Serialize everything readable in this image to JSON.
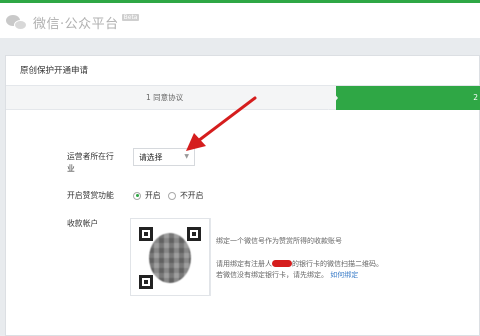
{
  "header": {
    "title": "微信·公众平台",
    "badge": "Beta"
  },
  "card": {
    "title": "原创保护开通申请"
  },
  "steps": {
    "current_label": "1 同意协议",
    "next_number": "2"
  },
  "form": {
    "industry_label_line1": "运营者所在行",
    "industry_label_line2": "业",
    "industry_select_value": "请选择",
    "reward_label": "开启赞赏功能",
    "reward_on_label": "开启",
    "reward_off_label": "不开启",
    "reward_selected": "开启",
    "account_label": "收款帐户"
  },
  "qr_panel": {
    "line1": "绑定一个微信号作为赞赏所得的收款账号",
    "line2_prefix": "请用绑定有注册人",
    "line2_suffix": "的银行卡的微信扫描二维码。",
    "line3_prefix": "若微信没有绑定银行卡，请先绑定。",
    "line3_link": "如何绑定"
  },
  "colors": {
    "accent_green": "#2fa745",
    "annotation_red": "#d51d1d",
    "link_blue": "#3a7cc8"
  },
  "icons": [
    "wechat-logo-icon",
    "chevron-down-icon",
    "qr-code-icon",
    "red-arrow-annotation"
  ]
}
